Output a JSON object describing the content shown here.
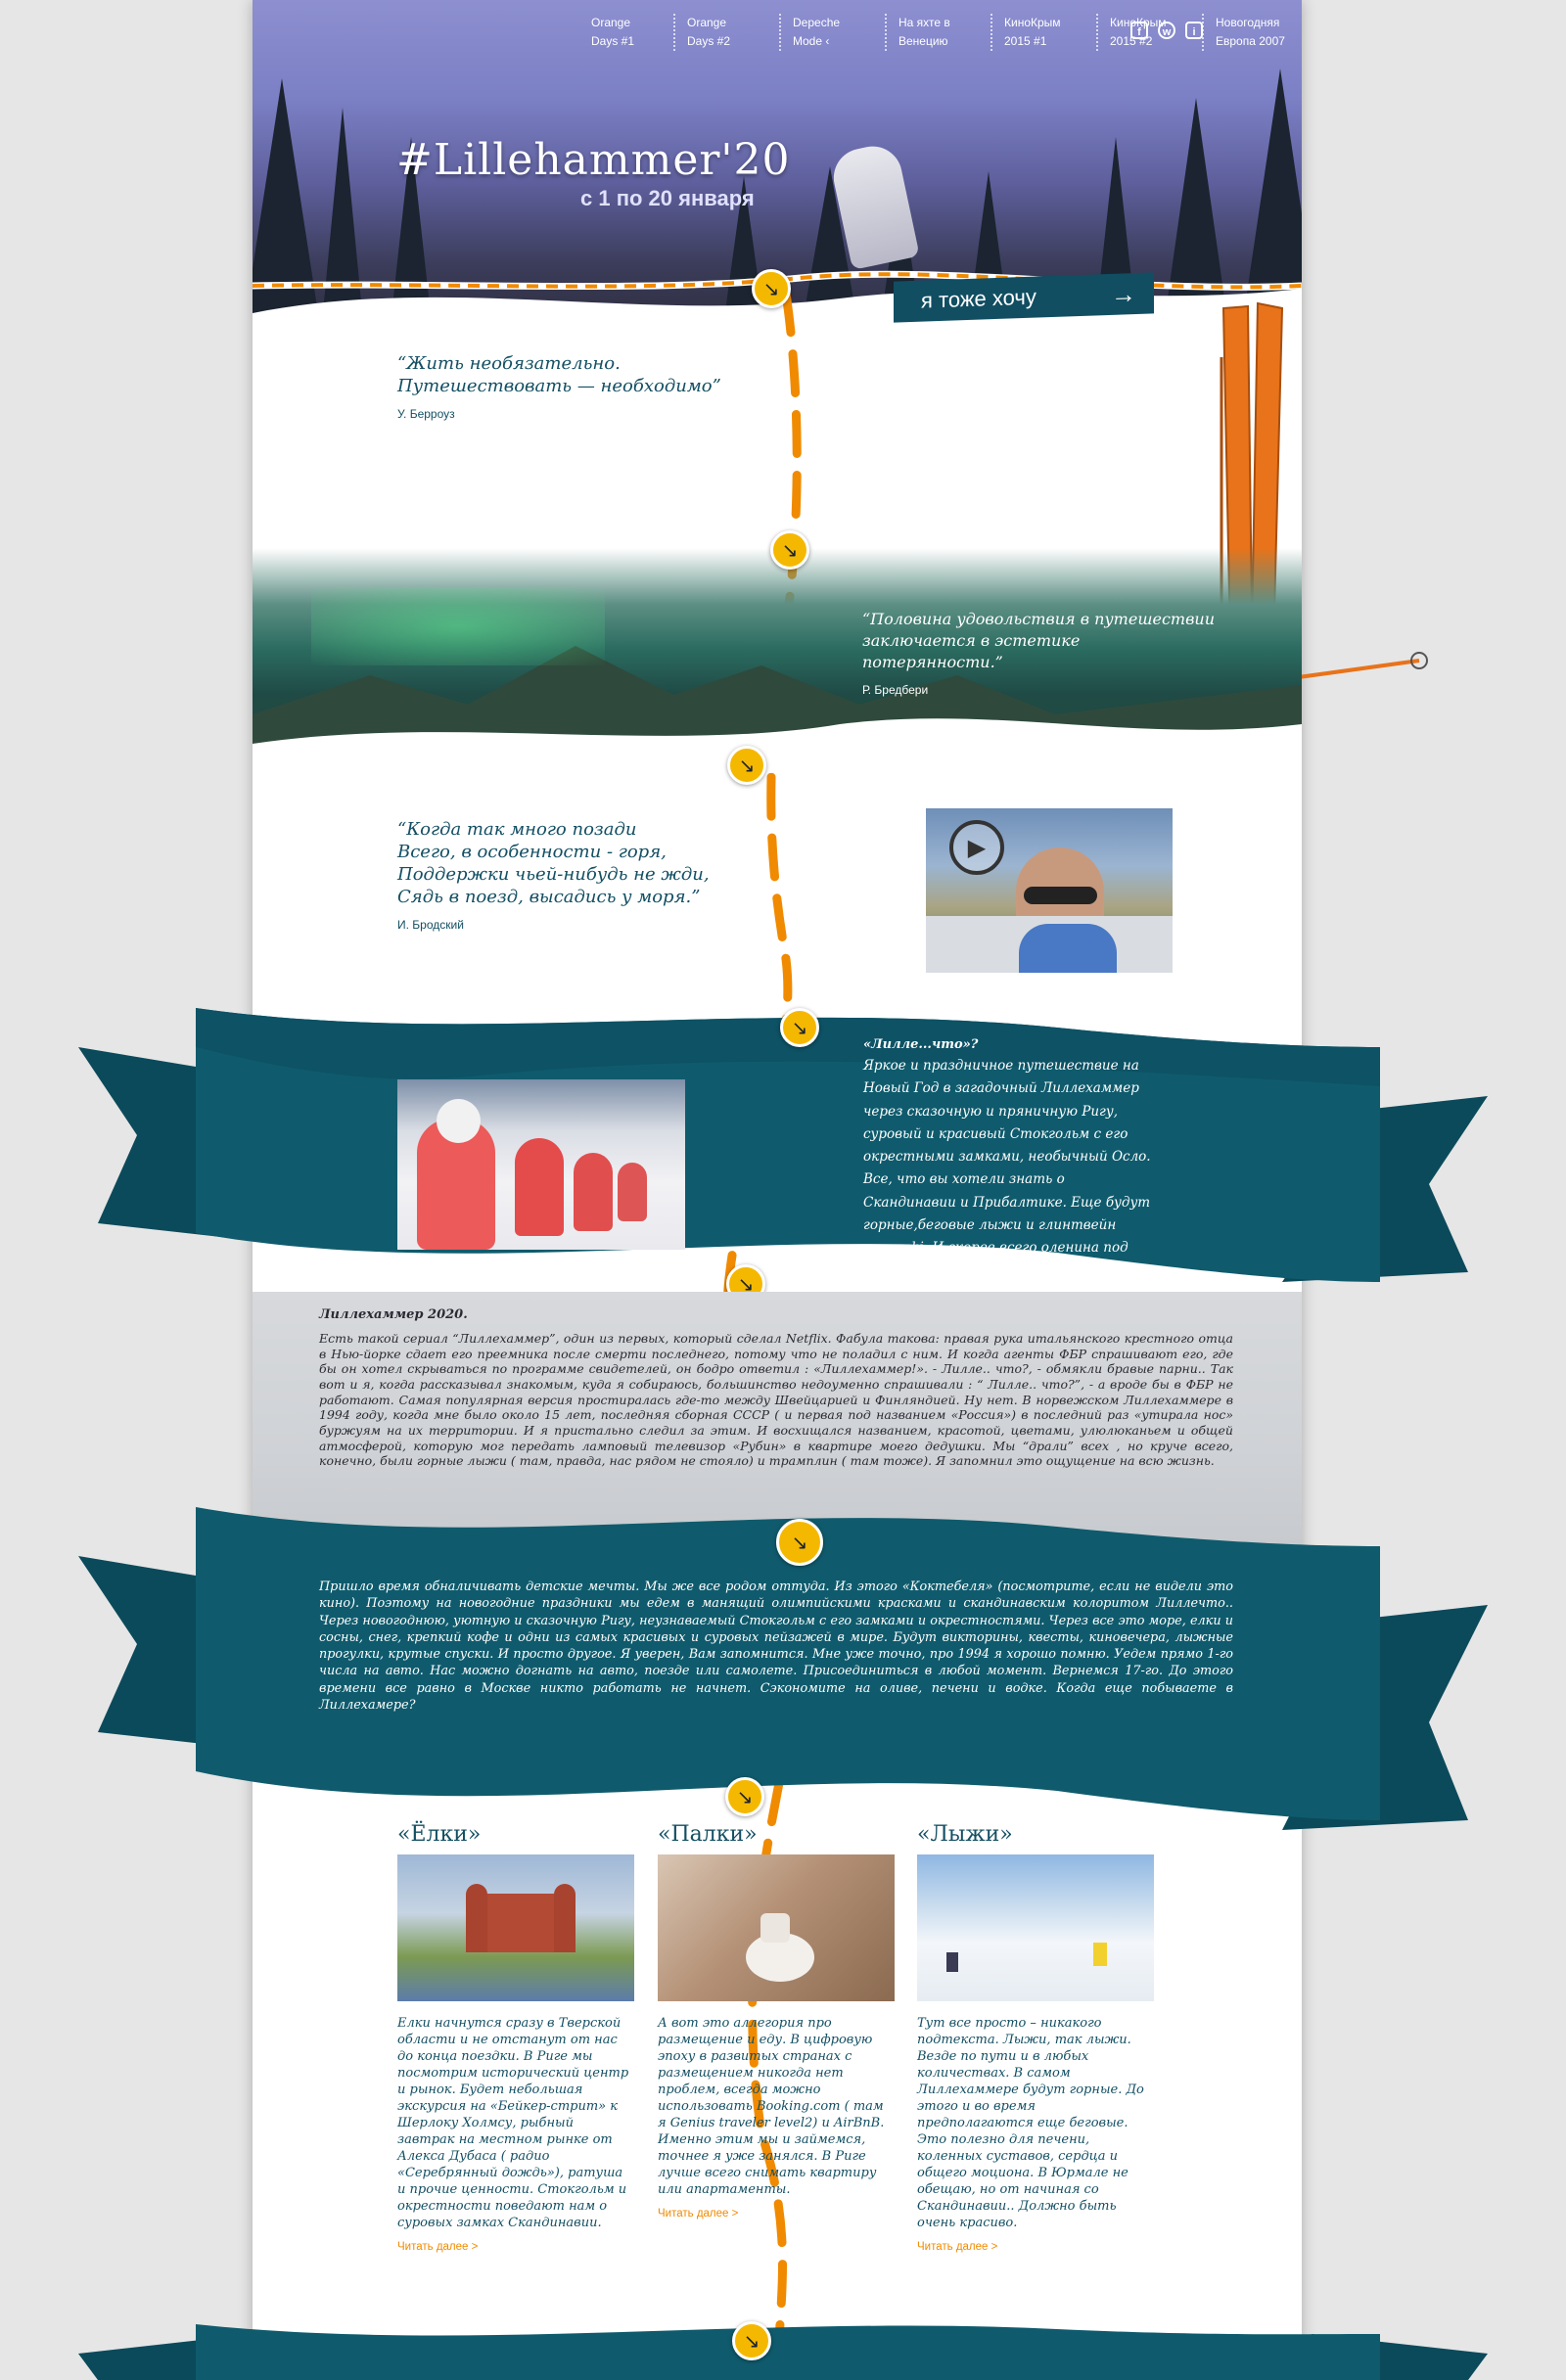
{
  "nav": [
    {
      "line1": "Orange",
      "line2": "Days #1"
    },
    {
      "line1": "Orange",
      "line2": "Days #2"
    },
    {
      "line1": "Depeche",
      "line2": "Mode ‹"
    },
    {
      "line1": "На яхте в",
      "line2": "Венецию"
    },
    {
      "line1": "КиноКрым",
      "line2": "2015 #1"
    },
    {
      "line1": "КиноКрым",
      "line2": "2015 #2"
    },
    {
      "line1": "Новогодняя",
      "line2": "Европа 2007"
    }
  ],
  "social": {
    "facebook": "f",
    "whatsapp": "w",
    "instagram": "i"
  },
  "hero": {
    "title": "#Lillehammer'20",
    "subtitle": "с 1 по 20 января",
    "cta_label": "я тоже хочу",
    "cta_arrow": "→"
  },
  "quote1": {
    "line1": "“Жить необязательно.",
    "line2": "Путешествовать — необходимо”",
    "author": "У. Берроуз"
  },
  "quote2": {
    "line1": "“Половина удовольствия в путешествии",
    "line2": "заключается в эстетике потерянности.”",
    "author": "Р. Бредбери"
  },
  "quote3": {
    "line1": "“Когда так много позади",
    "line2": "Всего, в особенности - горя,",
    "line3": "Поддержки чьей-нибудь не жди,",
    "line4": "Сядь в поезд, высадись у моря.”",
    "author": "И. Бродский"
  },
  "ribbon1": {
    "heading": "«Лилле...что»?",
    "text": "Яркое и праздничное путешествие на Новый Год в загадочный Лиллехаммер через сказочную и пряничную Ригу, суровый и красивый Стокгольм с его окрестными замками, необычный Осло. Все, что вы хотели знать о Скандинавии и Прибалтике. Еще будут горные,беговые лыжи и глинтвейн apres ski. И скорее всего оленина под клюквенным соусом."
  },
  "story": {
    "heading": "Лиллехаммер 2020.",
    "text": "Есть такой сериал “Лиллехаммер”, один из первых, который сделал Netflix. Фабула такова: правая рука итальянского крестного отца в Нью-йорке сдает его преемника после смерти последнего, потому что не поладил с ним. И когда агенты ФБР спрашивают его, где бы он хотел скрываться по программе свидетелей, он бодро ответил : «Лиллехаммер!». - Лилле.. что?, - обмякли бравые парни.. Так вот и я, когда рассказывал знакомым, куда я собираюсь, большинство недоуменно спрашивали : “ Лилле.. что?”, - а вроде бы в ФБР не работают. Самая популярная версия простиралась где-то между Швейцарией и Финляндией. Ну нет. В норвежском Лиллехаммере в 1994 году, когда мне было около 15 лет, последняя сборная СССР ( и первая под названием «Россия») в последний раз «утирала нос» буржуям на их территории. И я пристально следил за этим. И восхищался названием, красотой, цветами, улюлюканьем и общей атмосферой, которую мог передать ламповый телевизор «Рубин» в квартире моего дедушки. Мы “драли” всех , но круче всего, конечно, были горные лыжи ( там, правда, нас рядом не стояло) и трамплин ( там тоже). Я запомнил это ощущение на всю жизнь."
  },
  "ribbon2": {
    "text": "Пришло время обналичивать детские мечты. Мы же все родом оттуда. Из этого «Коктебеля» (посмотрите, если не видели это кино). Поэтому на новогодние праздники мы едем в манящий олимпийскими красками и скандинавским колоритом Лиллечто.. Через новогоднюю, уютную и сказочную Ригу, неузнаваемый Стокгольм с его замками и окрестностями. Через все это море, елки и сосны, снег, крепкий кофе и одни из самых красивых и суровых пейзажей в мире. Будут викторины, квесты, киновечера, лыжные прогулки, крутые спуски. И просто другое. Я уверен, Вам запомнится. Мне уже точно, про 1994 я хорошо помню. Уедем прямо 1-го числа на авто. Нас можно догнать на авто, поезде или самолете. Присоединиться в любой момент. Вернемся 17-го. До этого времени все равно в Москве никто работать не начнет. Сэкономите на оливе, печени и водке. Когда еще побываете в Лиллехамере?"
  },
  "columns": [
    {
      "title": "«Ёлки»",
      "text": "Елки начнутся сразу в Тверской области и не отстанут от нас до конца поездки. В Риге мы посмотрим исторический центр и рынок. Будет небольшая экскурсия на «Бейкер-стрит» к Шерлоку Холмсу, рыбный завтрак на местном рынке от Алекса Дубаса ( радио «Серебрянный дождь»), ратуша и прочие ценности. Стокгольм и окрестности поведают нам о суровых замках Скандинавии.",
      "more": "Читать далее >"
    },
    {
      "title": "«Палки»",
      "text": "А вот это аллегория про размещение и еду. В цифровую эпоху в развитых странах с размещением никогда нет проблем, всегда можно использовать Booking.com ( там я Genius traveler level2) и AirBnB. Именно этим мы и займемся, точнее я уже занялся. В Риге лучше всего снимать квартиру или апартаменты.",
      "more": "Читать далее >"
    },
    {
      "title": "«Лыжи»",
      "text": "Тут все просто – никакого подтекста. Лыжи, так лыжи. Везде по пути и в любых количествах. В самом Лиллехаммере будут горные. До этого и во время предполагаются еще беговые. Это полезно для печени, коленных суставов, сердца и общего моциона. В Юрмале не обещаю, но от начиная со Скандинавии.. Должно быть очень красиво.",
      "more": "Читать далее >"
    }
  ],
  "colors": {
    "teal": "#0f5b6d",
    "accent": "#f08a00",
    "marker": "#f5b800",
    "text": "#134f63"
  },
  "icons": {
    "marker": "↘",
    "play": "▶"
  }
}
